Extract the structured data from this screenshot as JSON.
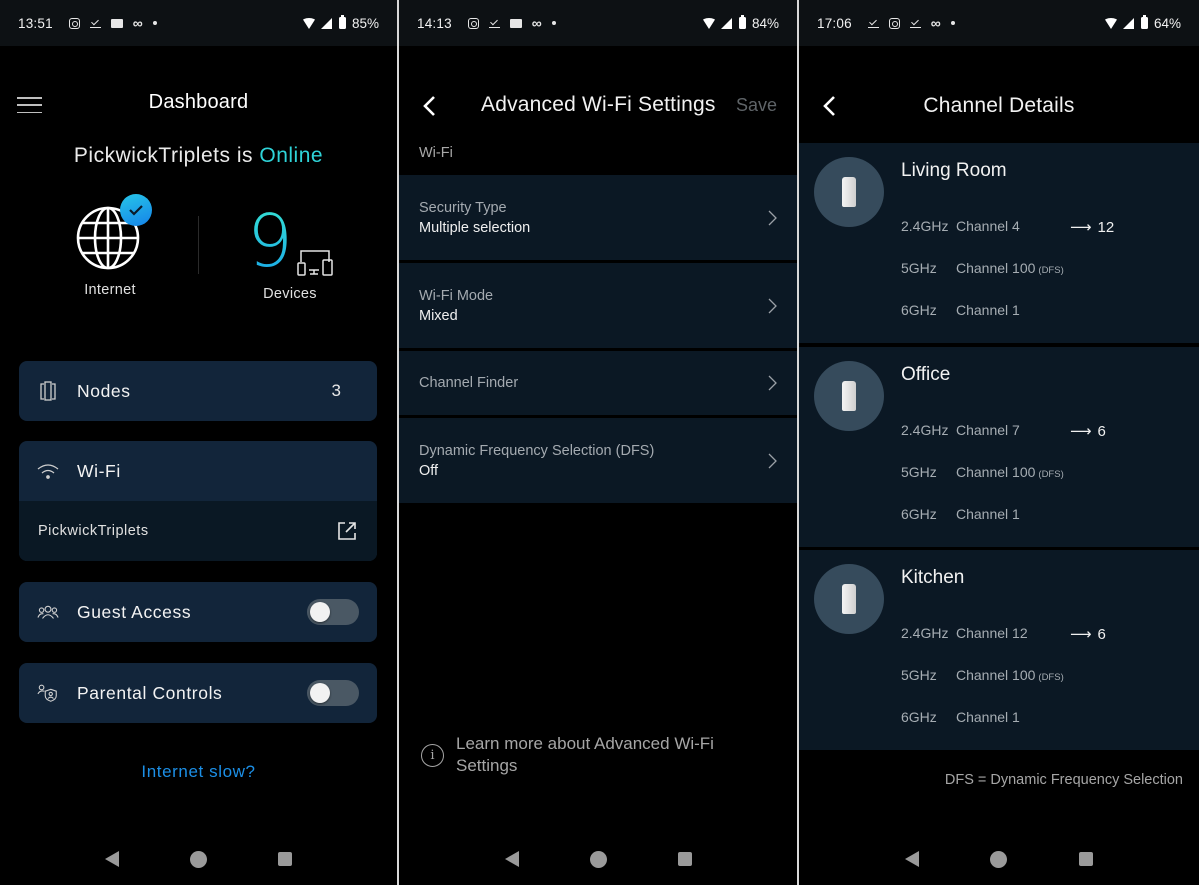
{
  "screens": [
    {
      "status_bar": {
        "time": "13:51",
        "battery": "85%"
      },
      "dashboard": {
        "title": "Dashboard",
        "network_name": "PickwickTriplets",
        "status_prefix": "is",
        "status": "Online",
        "internet_label": "Internet",
        "devices_count": "9",
        "devices_label": "Devices",
        "nodes": {
          "label": "Nodes",
          "count": "3"
        },
        "wifi": {
          "label": "Wi-Fi",
          "ssid": "PickwickTriplets"
        },
        "guest_access": {
          "label": "Guest Access",
          "enabled": false
        },
        "parental_controls": {
          "label": "Parental Controls",
          "enabled": false
        },
        "internet_slow_link": "Internet slow?"
      }
    },
    {
      "status_bar": {
        "time": "14:13",
        "battery": "84%"
      },
      "advanced": {
        "title": "Advanced Wi-Fi Settings",
        "save_label": "Save",
        "section_label": "Wi-Fi",
        "rows": [
          {
            "name": "Security Type",
            "value": "Multiple selection"
          },
          {
            "name": "Wi-Fi Mode",
            "value": "Mixed"
          },
          {
            "name": "Channel Finder",
            "value": ""
          },
          {
            "name": "Dynamic Frequency Selection (DFS)",
            "value": "Off"
          }
        ],
        "learn_more": "Learn more about Advanced Wi-Fi Settings"
      }
    },
    {
      "status_bar": {
        "time": "17:06",
        "battery": "64%"
      },
      "channels": {
        "title": "Channel Details",
        "nodes": [
          {
            "name": "Living Room",
            "bands": [
              {
                "band": "2.4GHz",
                "channel": "Channel 4",
                "dfs": "",
                "new_channel": "12"
              },
              {
                "band": "5GHz",
                "channel": "Channel 100",
                "dfs": "(DFS)",
                "new_channel": ""
              },
              {
                "band": "6GHz",
                "channel": "Channel 1",
                "dfs": "",
                "new_channel": ""
              }
            ]
          },
          {
            "name": "Office",
            "bands": [
              {
                "band": "2.4GHz",
                "channel": "Channel 7",
                "dfs": "",
                "new_channel": "6"
              },
              {
                "band": "5GHz",
                "channel": "Channel 100",
                "dfs": "(DFS)",
                "new_channel": ""
              },
              {
                "band": "6GHz",
                "channel": "Channel 1",
                "dfs": "",
                "new_channel": ""
              }
            ]
          },
          {
            "name": "Kitchen",
            "bands": [
              {
                "band": "2.4GHz",
                "channel": "Channel 12",
                "dfs": "",
                "new_channel": "6"
              },
              {
                "band": "5GHz",
                "channel": "Channel 100",
                "dfs": "(DFS)",
                "new_channel": ""
              },
              {
                "band": "6GHz",
                "channel": "Channel 1",
                "dfs": "",
                "new_channel": ""
              }
            ]
          }
        ],
        "footnote": "DFS = Dynamic Frequency Selection"
      }
    }
  ],
  "colors": {
    "accent_online": "#2fd4d9",
    "link_blue": "#1c8fe6",
    "card_bg": "#12253a",
    "row_bg": "#0b1824"
  }
}
